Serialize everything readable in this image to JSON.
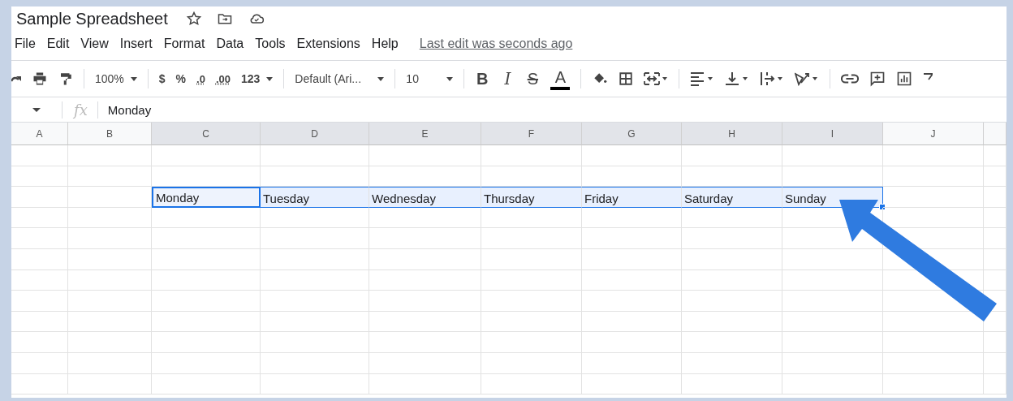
{
  "title": "Sample Spreadsheet",
  "menu": [
    "File",
    "Edit",
    "View",
    "Insert",
    "Format",
    "Data",
    "Tools",
    "Extensions",
    "Help"
  ],
  "last_edit": "Last edit was seconds ago",
  "toolbar": {
    "zoom": "100%",
    "currency": "$",
    "percent": "%",
    "decrease_decimals": ".0",
    "increase_decimals": ".00",
    "number_format": "123",
    "font": "Default (Ari...",
    "font_size": "10",
    "bold": "B",
    "italic": "I",
    "strikethrough": "S",
    "text_color": "A"
  },
  "formula_bar": {
    "fx": "fx",
    "value": "Monday"
  },
  "columns": [
    {
      "label": "A",
      "selected": false
    },
    {
      "label": "B",
      "selected": false
    },
    {
      "label": "C",
      "selected": true
    },
    {
      "label": "D",
      "selected": true
    },
    {
      "label": "E",
      "selected": true
    },
    {
      "label": "F",
      "selected": true
    },
    {
      "label": "G",
      "selected": true
    },
    {
      "label": "H",
      "selected": true
    },
    {
      "label": "I",
      "selected": true
    },
    {
      "label": "J",
      "selected": false
    }
  ],
  "range": {
    "cells": [
      {
        "text": "Monday",
        "active": true
      },
      {
        "text": "Tuesday",
        "active": false
      },
      {
        "text": "Wednesday",
        "active": false
      },
      {
        "text": "Thursday",
        "active": false
      },
      {
        "text": "Friday",
        "active": false
      },
      {
        "text": "Saturday",
        "active": false
      },
      {
        "text": "Sunday",
        "active": false
      }
    ]
  }
}
